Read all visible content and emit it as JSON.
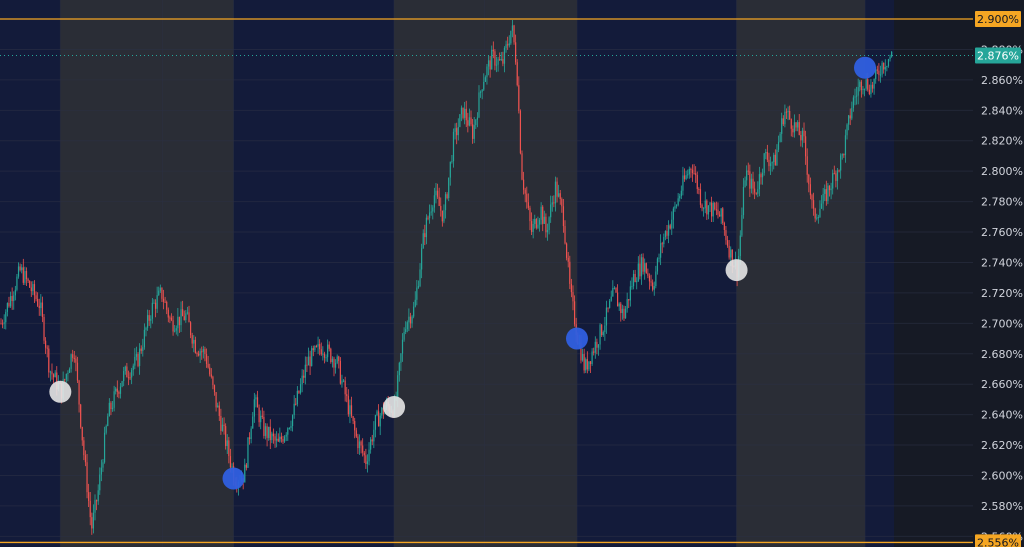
{
  "chart_data": {
    "type": "candlestick",
    "title": "",
    "xlabel": "",
    "ylabel": "",
    "ylim": [
      2.553,
      2.9125
    ],
    "y_ticks": [
      "2.560%",
      "2.580%",
      "2.600%",
      "2.620%",
      "2.640%",
      "2.660%",
      "2.680%",
      "2.700%",
      "2.720%",
      "2.740%",
      "2.760%",
      "2.780%",
      "2.800%",
      "2.820%",
      "2.840%",
      "2.860%",
      "2.880%"
    ],
    "y_tick_values": [
      2.56,
      2.58,
      2.6,
      2.62,
      2.64,
      2.66,
      2.68,
      2.7,
      2.72,
      2.74,
      2.76,
      2.78,
      2.8,
      2.82,
      2.84,
      2.86,
      2.88
    ],
    "grid": true,
    "colors": {
      "background": "#161a25",
      "session_band_dark": "#131b3a",
      "session_band_gray": "#2a2d36",
      "candle_up": "#26a69a",
      "candle_down": "#ef5350",
      "level_line": "#f5a623",
      "last_price": "#26a69a",
      "marker_blue": "#2f5fe0",
      "marker_white": "#e6e6e6",
      "axis_text": "#d1d4dc"
    },
    "session_bands": [
      {
        "x_start": 0.0,
        "x_end": 0.062,
        "shade": "dark"
      },
      {
        "x_start": 0.062,
        "x_end": 0.24,
        "shade": "gray"
      },
      {
        "x_start": 0.24,
        "x_end": 0.405,
        "shade": "dark"
      },
      {
        "x_start": 0.405,
        "x_end": 0.593,
        "shade": "gray"
      },
      {
        "x_start": 0.593,
        "x_end": 0.757,
        "shade": "dark"
      },
      {
        "x_start": 0.757,
        "x_end": 0.889,
        "shade": "gray"
      },
      {
        "x_start": 0.889,
        "x_end": 0.919,
        "shade": "dark"
      }
    ],
    "series": [
      {
        "type": "close-path",
        "points": [
          [
            0.0,
            2.7
          ],
          [
            0.02,
            2.735
          ],
          [
            0.04,
            2.712
          ],
          [
            0.05,
            2.67
          ],
          [
            0.062,
            2.655
          ],
          [
            0.075,
            2.685
          ],
          [
            0.085,
            2.615
          ],
          [
            0.093,
            2.565
          ],
          [
            0.1,
            2.59
          ],
          [
            0.11,
            2.64
          ],
          [
            0.125,
            2.665
          ],
          [
            0.14,
            2.675
          ],
          [
            0.155,
            2.71
          ],
          [
            0.165,
            2.72
          ],
          [
            0.175,
            2.7
          ],
          [
            0.19,
            2.705
          ],
          [
            0.2,
            2.685
          ],
          [
            0.21,
            2.68
          ],
          [
            0.22,
            2.65
          ],
          [
            0.23,
            2.625
          ],
          [
            0.24,
            2.598
          ],
          [
            0.25,
            2.6
          ],
          [
            0.26,
            2.65
          ],
          [
            0.27,
            2.63
          ],
          [
            0.285,
            2.62
          ],
          [
            0.3,
            2.64
          ],
          [
            0.315,
            2.675
          ],
          [
            0.33,
            2.685
          ],
          [
            0.345,
            2.675
          ],
          [
            0.355,
            2.65
          ],
          [
            0.365,
            2.625
          ],
          [
            0.375,
            2.61
          ],
          [
            0.385,
            2.635
          ],
          [
            0.395,
            2.645
          ],
          [
            0.405,
            2.645
          ],
          [
            0.415,
            2.7
          ],
          [
            0.425,
            2.71
          ],
          [
            0.435,
            2.76
          ],
          [
            0.445,
            2.785
          ],
          [
            0.455,
            2.77
          ],
          [
            0.465,
            2.82
          ],
          [
            0.475,
            2.84
          ],
          [
            0.485,
            2.825
          ],
          [
            0.495,
            2.86
          ],
          [
            0.505,
            2.875
          ],
          [
            0.515,
            2.87
          ],
          [
            0.525,
            2.895
          ],
          [
            0.53,
            2.87
          ],
          [
            0.535,
            2.8
          ],
          [
            0.545,
            2.76
          ],
          [
            0.555,
            2.775
          ],
          [
            0.56,
            2.76
          ],
          [
            0.57,
            2.79
          ],
          [
            0.578,
            2.77
          ],
          [
            0.585,
            2.72
          ],
          [
            0.593,
            2.69
          ],
          [
            0.6,
            2.67
          ],
          [
            0.61,
            2.685
          ],
          [
            0.62,
            2.7
          ],
          [
            0.63,
            2.72
          ],
          [
            0.64,
            2.705
          ],
          [
            0.65,
            2.73
          ],
          [
            0.66,
            2.74
          ],
          [
            0.67,
            2.725
          ],
          [
            0.68,
            2.755
          ],
          [
            0.69,
            2.77
          ],
          [
            0.7,
            2.79
          ],
          [
            0.71,
            2.805
          ],
          [
            0.72,
            2.78
          ],
          [
            0.73,
            2.775
          ],
          [
            0.74,
            2.77
          ],
          [
            0.75,
            2.745
          ],
          [
            0.757,
            2.735
          ],
          [
            0.765,
            2.8
          ],
          [
            0.775,
            2.785
          ],
          [
            0.785,
            2.81
          ],
          [
            0.795,
            2.805
          ],
          [
            0.805,
            2.84
          ],
          [
            0.815,
            2.83
          ],
          [
            0.825,
            2.82
          ],
          [
            0.835,
            2.77
          ],
          [
            0.845,
            2.78
          ],
          [
            0.855,
            2.795
          ],
          [
            0.865,
            2.81
          ],
          [
            0.875,
            2.845
          ],
          [
            0.885,
            2.86
          ],
          [
            0.895,
            2.855
          ],
          [
            0.905,
            2.87
          ],
          [
            0.915,
            2.876
          ]
        ]
      }
    ],
    "level_lines": [
      {
        "label": "2.900%",
        "value": 2.9
      },
      {
        "label": "2.556%",
        "value": 2.556
      }
    ],
    "last_price": {
      "label": "2.876%",
      "value": 2.876
    },
    "markers": [
      {
        "x": 0.062,
        "y": 2.655,
        "color": "white"
      },
      {
        "x": 0.24,
        "y": 2.598,
        "color": "blue"
      },
      {
        "x": 0.405,
        "y": 2.645,
        "color": "white"
      },
      {
        "x": 0.593,
        "y": 2.69,
        "color": "blue"
      },
      {
        "x": 0.757,
        "y": 2.735,
        "color": "white"
      },
      {
        "x": 0.889,
        "y": 2.868,
        "color": "blue"
      }
    ]
  }
}
